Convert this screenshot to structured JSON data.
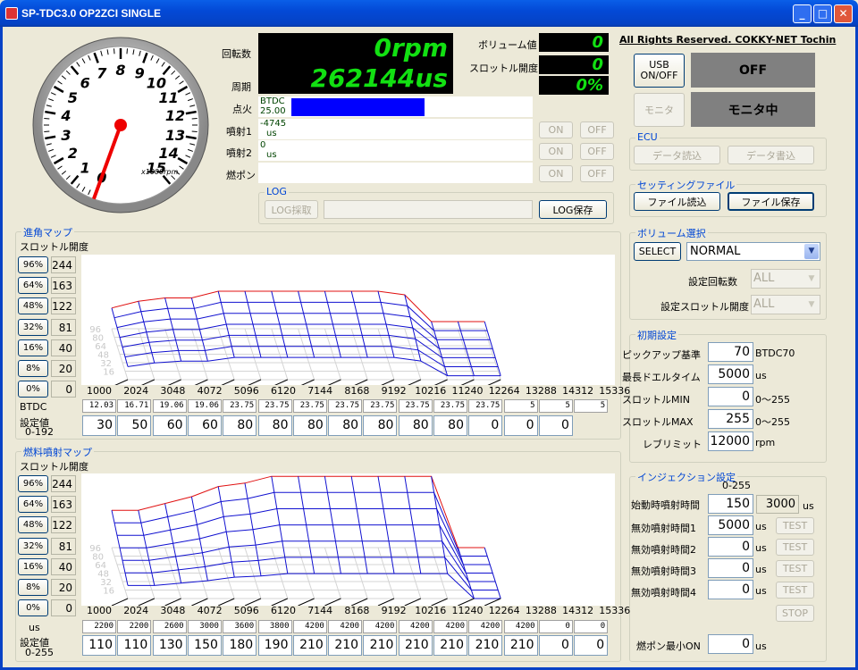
{
  "window": {
    "title": "SP-TDC3.0 OP2ZCI SINGLE",
    "min": "_",
    "max": "□",
    "close": "✕"
  },
  "header": {
    "copyright": "All Rights Reserved. COKKY-NET Tochin"
  },
  "gauge": {
    "ticks": [
      "0",
      "1",
      "2",
      "3",
      "4",
      "5",
      "6",
      "7",
      "8",
      "9",
      "10",
      "11",
      "12",
      "13",
      "14",
      "15"
    ],
    "unit": "x1000rpm",
    "needle_rpm": 0
  },
  "displays": {
    "rpm_label": "回転数",
    "rpm_value": "0rpm",
    "period_label": "周期",
    "period_value": "262144us",
    "volume_label": "ボリューム値",
    "volume_value": "0",
    "throttle_label": "スロットル開度",
    "throttle_value": "0",
    "throttle_pct": "0%"
  },
  "indicators": [
    {
      "label": "点火",
      "top": "BTDC",
      "bottom": "25.00",
      "fill": 0.55
    },
    {
      "label": "噴射1",
      "top": "-4745",
      "bottom": "us",
      "fill": 0
    },
    {
      "label": "噴射2",
      "top": "0",
      "bottom": "us",
      "fill": 0
    },
    {
      "label": "燃ポン",
      "top": "",
      "bottom": "",
      "fill": 0
    }
  ],
  "onoff": {
    "on": "ON",
    "off": "OFF"
  },
  "log": {
    "title": "LOG",
    "collect": "LOG採取",
    "save": "LOG保存"
  },
  "usb": {
    "button": "USB ON/OFF",
    "status": "OFF"
  },
  "monitor": {
    "button": "モニタ",
    "status": "モニタ中"
  },
  "ecu": {
    "title": "ECU",
    "read": "データ読込",
    "write": "データ書込"
  },
  "setting_file": {
    "title": "セッティングファイル",
    "read": "ファイル読込",
    "save": "ファイル保存"
  },
  "volume_select": {
    "title": "ボリューム選択",
    "select": "SELECT",
    "mode": "NORMAL",
    "rpm_label": "設定回転数",
    "rpm_val": "ALL",
    "thr_label": "設定スロットル開度",
    "thr_val": "ALL"
  },
  "initial": {
    "title": "初期設定",
    "rows": [
      {
        "label": "ピックアップ基準",
        "value": "70",
        "unit": "BTDC70"
      },
      {
        "label": "最長ドエルタイム",
        "value": "5000",
        "unit": "us"
      },
      {
        "label": "スロットルMIN",
        "value": "0",
        "unit": "0～255"
      },
      {
        "label": "スロットルMAX",
        "value": "255",
        "unit": "0～255"
      },
      {
        "label": "レブリミット",
        "value": "12000",
        "unit": "rpm"
      }
    ]
  },
  "injection": {
    "title": "インジェクション設定",
    "range": "0-255",
    "start_label": "始動時噴射時間",
    "start_value": "150",
    "start_us": "3000",
    "us": "us",
    "rows": [
      {
        "label": "無効噴射時間1",
        "value": "5000",
        "test": "TEST"
      },
      {
        "label": "無効噴射時間2",
        "value": "0",
        "test": "TEST"
      },
      {
        "label": "無効噴射時間3",
        "value": "0",
        "test": "TEST"
      },
      {
        "label": "無効噴射時間4",
        "value": "0",
        "test": "TEST"
      }
    ],
    "stop": "STOP",
    "pump_label": "燃ポン最小ON",
    "pump_value": "0"
  },
  "ignition_map": {
    "title": "進角マップ",
    "throttle_label": "スロットル開度",
    "btdc_label": "BTDC",
    "set_label": "設定値",
    "set_range": "0-192",
    "throttle": [
      {
        "pct": "96%",
        "val": "244"
      },
      {
        "pct": "64%",
        "val": "163"
      },
      {
        "pct": "48%",
        "val": "122"
      },
      {
        "pct": "32%",
        "val": "81"
      },
      {
        "pct": "16%",
        "val": "40"
      },
      {
        "pct": "8%",
        "val": "20"
      },
      {
        "pct": "0%",
        "val": "0"
      }
    ],
    "surface_labels": [
      "96",
      "80",
      "64",
      "48",
      "32",
      "16"
    ],
    "rpm": [
      "1000",
      "2024",
      "3048",
      "4072",
      "5096",
      "6120",
      "7144",
      "8168",
      "9192",
      "10216",
      "11240",
      "12264",
      "13288",
      "14312",
      "15336"
    ],
    "btdc": [
      "12.03",
      "16.71",
      "19.06",
      "19.06",
      "23.75",
      "23.75",
      "23.75",
      "23.75",
      "23.75",
      "23.75",
      "23.75",
      "23.75",
      "5",
      "5",
      "5"
    ],
    "values": [
      "30",
      "50",
      "60",
      "60",
      "80",
      "80",
      "80",
      "80",
      "80",
      "80",
      "80",
      "0",
      "0",
      "0"
    ]
  },
  "fuel_map": {
    "title": "燃料噴射マップ",
    "throttle_label": "スロットル開度",
    "us_label": "us",
    "set_label": "設定値",
    "set_range": "0-255",
    "throttle": [
      {
        "pct": "96%",
        "val": "244"
      },
      {
        "pct": "64%",
        "val": "163"
      },
      {
        "pct": "48%",
        "val": "122"
      },
      {
        "pct": "32%",
        "val": "81"
      },
      {
        "pct": "16%",
        "val": "40"
      },
      {
        "pct": "8%",
        "val": "20"
      },
      {
        "pct": "0%",
        "val": "0"
      }
    ],
    "surface_labels": [
      "96",
      "80",
      "64",
      "48",
      "32",
      "16"
    ],
    "rpm": [
      "1000",
      "2024",
      "3048",
      "4072",
      "5096",
      "6120",
      "7144",
      "8168",
      "9192",
      "10216",
      "11240",
      "12264",
      "13288",
      "14312",
      "15336"
    ],
    "us": [
      "2200",
      "2200",
      "2600",
      "3000",
      "3600",
      "3800",
      "4200",
      "4200",
      "4200",
      "4200",
      "4200",
      "4200",
      "4200",
      "0",
      "0"
    ],
    "values": [
      "110",
      "110",
      "130",
      "150",
      "180",
      "190",
      "210",
      "210",
      "210",
      "210",
      "210",
      "210",
      "210",
      "0",
      "0"
    ]
  }
}
